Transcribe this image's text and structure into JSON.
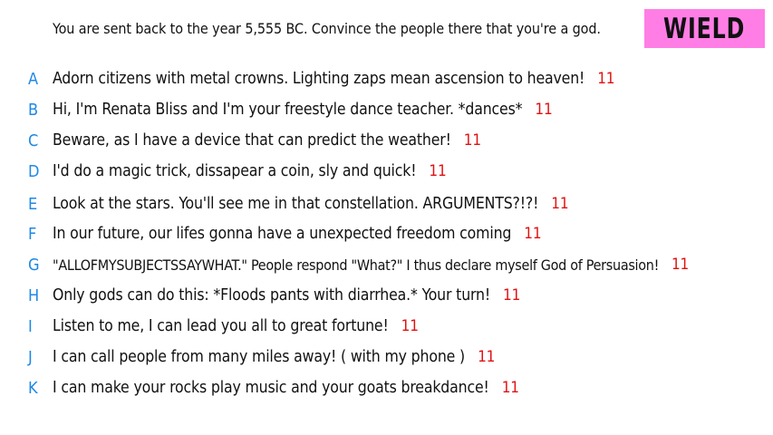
{
  "prompt": "You are sent back to the year 5,555 BC. Convince the people there that you're a god.",
  "badge": "WIELD",
  "colors": {
    "badge_bg": "#ff7ee6",
    "letter": "#1e88e5",
    "score": "#e01010"
  },
  "answers": [
    {
      "letter": "A",
      "text": "Adorn citizens with metal crowns. Lighting zaps mean ascension to heaven!",
      "score": "11"
    },
    {
      "letter": "B",
      "text": "Hi, I'm Renata Bliss and I'm your freestyle dance teacher. *dances*",
      "score": "11"
    },
    {
      "letter": "C",
      "text": "Beware, as I have a device that can predict the weather!",
      "score": "11"
    },
    {
      "letter": "D",
      "text": "I'd do a magic trick, dissapear a coin, sly and quick!",
      "score": "11"
    },
    {
      "letter": "E",
      "text": "Look at the stars. You'll see me in that constellation. ARGUMENTS?!?!",
      "score": "11"
    },
    {
      "letter": "F",
      "text": "In our future, our lifes gonna have a unexpected freedom coming",
      "score": "11"
    },
    {
      "letter": "G",
      "text": "\"ALLOFMYSUBJECTSSAYWHAT.\" People respond \"What?\" I thus declare myself God of Persuasion!",
      "score": "11"
    },
    {
      "letter": "H",
      "text": "Only gods can do this: *Floods pants with diarrhea.* Your turn!",
      "score": "11"
    },
    {
      "letter": "I",
      "text": "Listen to me, I can lead you all to great fortune!",
      "score": "11"
    },
    {
      "letter": "J",
      "text": "I can call people from many miles away! ( with my phone )",
      "score": "11"
    },
    {
      "letter": "K",
      "text": "I can make your rocks play music and your goats breakdance!",
      "score": "11"
    }
  ]
}
